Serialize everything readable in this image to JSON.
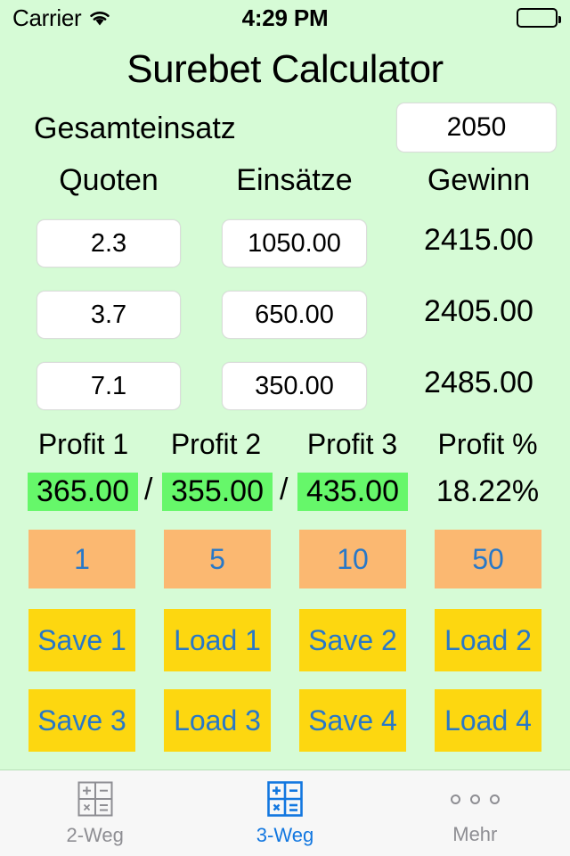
{
  "status_bar": {
    "carrier": "Carrier",
    "wifi_icon": "wifi-icon",
    "time": "4:29 PM",
    "battery_icon": "battery-full-icon"
  },
  "app": {
    "title": "Surebet Calculator",
    "background_color": "#d6fbd6"
  },
  "total_stake": {
    "label": "Gesamteinsatz",
    "value": "2050",
    "placeholder": "Gesamteinsatz"
  },
  "columns": {
    "odds": "Quoten",
    "stakes": "Einsätze",
    "winnings": "Gewinn"
  },
  "bets": [
    {
      "odds": "2.3",
      "stake": "1050.00",
      "winning": "2415.00"
    },
    {
      "odds": "3.7",
      "stake": "650.00",
      "winning": "2405.00"
    },
    {
      "odds": "7.1",
      "stake": "350.00",
      "winning": "2485.00"
    }
  ],
  "profit": {
    "headers": [
      "Profit 1",
      "Profit 2",
      "Profit 3",
      "Profit %"
    ],
    "values": [
      "365.00",
      "355.00",
      "435.00",
      "18.22%"
    ],
    "separator": "/",
    "highlight_color": "#66f76a"
  },
  "quick_buttons": {
    "labels": [
      "1",
      "5",
      "10",
      "50"
    ],
    "background_color": "#fbb871",
    "text_color": "#2878c8"
  },
  "store_buttons": {
    "labels": [
      "Save 1",
      "Load 1",
      "Save 2",
      "Load 2",
      "Save 3",
      "Load 3",
      "Save 4",
      "Load 4"
    ],
    "background_color": "#fdd710",
    "text_color": "#2878c8"
  },
  "tab_bar": {
    "tabs": [
      {
        "label": "2-Weg",
        "icon": "calculator-icon",
        "active": false
      },
      {
        "label": "3-Weg",
        "icon": "calculator-icon",
        "active": true
      },
      {
        "label": "Mehr",
        "icon": "ellipsis-icon",
        "active": false
      }
    ],
    "active_color": "#1277e0",
    "inactive_color": "#8e8e93"
  }
}
